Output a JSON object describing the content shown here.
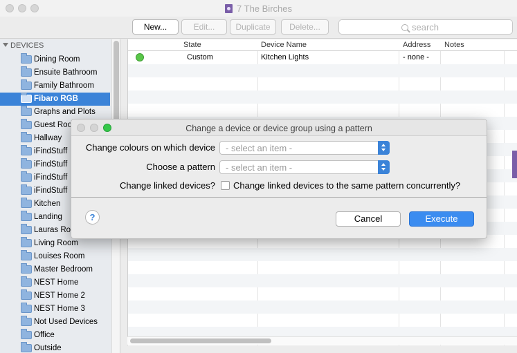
{
  "window": {
    "title": "7 The Birches"
  },
  "toolbar": {
    "new_label": "New...",
    "edit_label": "Edit...",
    "duplicate_label": "Duplicate",
    "delete_label": "Delete...",
    "search_placeholder": "search"
  },
  "sidebar": {
    "header": "DEVICES",
    "items": [
      {
        "label": "Dining Room"
      },
      {
        "label": "Ensuite Bathroom"
      },
      {
        "label": "Family Bathroom"
      },
      {
        "label": "Fibaro RGB",
        "selected": true
      },
      {
        "label": "Graphs and Plots"
      },
      {
        "label": "Guest Roo"
      },
      {
        "label": "Hallway"
      },
      {
        "label": "iFindStuff"
      },
      {
        "label": "iFindStuff"
      },
      {
        "label": "iFindStuff"
      },
      {
        "label": "iFindStuff"
      },
      {
        "label": "Kitchen"
      },
      {
        "label": "Landing"
      },
      {
        "label": "Lauras Ro"
      },
      {
        "label": "Living Room"
      },
      {
        "label": "Louises Room"
      },
      {
        "label": "Master Bedroom"
      },
      {
        "label": "NEST Home"
      },
      {
        "label": "NEST Home 2"
      },
      {
        "label": "NEST Home 3"
      },
      {
        "label": "Not Used Devices"
      },
      {
        "label": "Office"
      },
      {
        "label": "Outside"
      }
    ]
  },
  "table": {
    "columns": [
      "State",
      "Device Name",
      "Address",
      "Notes"
    ],
    "rows": [
      {
        "state": "Custom",
        "status_color": "#5ac64a",
        "device_name": "Kitchen Lights",
        "address": "- none -",
        "notes": ""
      }
    ]
  },
  "dialog": {
    "title": "Change a device or device group using a pattern",
    "fields": {
      "colours_label": "Change colours on which device",
      "colours_value": "- select an item -",
      "pattern_label": "Choose a pattern",
      "pattern_value": "- select an item -",
      "linked_label": "Change linked devices?",
      "linked_checkbox_label": "Change linked devices to the same pattern concurrently?",
      "linked_checked": false
    },
    "help_label": "?",
    "cancel_label": "Cancel",
    "execute_label": "Execute"
  },
  "colors": {
    "accent": "#3b83d8",
    "status_green": "#5ac64a"
  }
}
